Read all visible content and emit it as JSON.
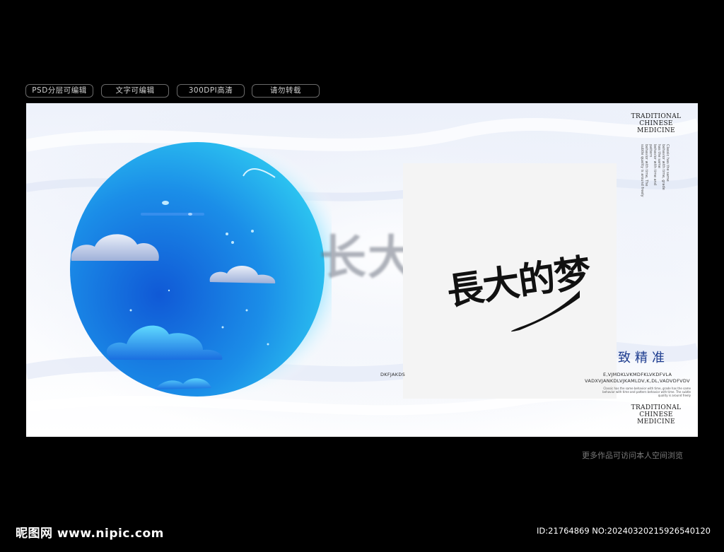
{
  "tags": [
    "PSD分层可编辑",
    "文字可编辑",
    "300DPI高清",
    "请勿转载"
  ],
  "poster": {
    "ghost_title": "长大的梦",
    "main_title": "長大的梦",
    "tcm_top": "TRADITIONAL CHINESE MEDICINE",
    "tcm_bottom": "TRADITIONAL CHINESE MEDICINE",
    "vertical_text": [
      "Classic has the same behavior with time, grade has the same",
      "behavior with time and pattern",
      "behavior with time, The subtle quality is around freely"
    ],
    "cn_subtitle": "致精准",
    "en_left": "DKFJAKDS",
    "en_right_1": "E,VJMDKLVKMDFKLVKDFVLA",
    "en_right_2": "VADXVJANKDLVJKAMLDV,K,DL,VADVDFVDV",
    "small_para": "Classic has the same behavior with time, grade has the same behavior with time and pattern behavior with time. The subtle quality is around freely"
  },
  "footer": {
    "link_note": "更多作品可访问本人空间浏览",
    "logo": "昵图网 www.nipic.com",
    "id_line": "ID:21764869 NO:20240320215926540120"
  },
  "colors": {
    "page_bg": "#000000",
    "moon_dark": "#0c4fc4",
    "moon_light": "#26c8f0",
    "accent_blue": "#1d3c8f"
  }
}
